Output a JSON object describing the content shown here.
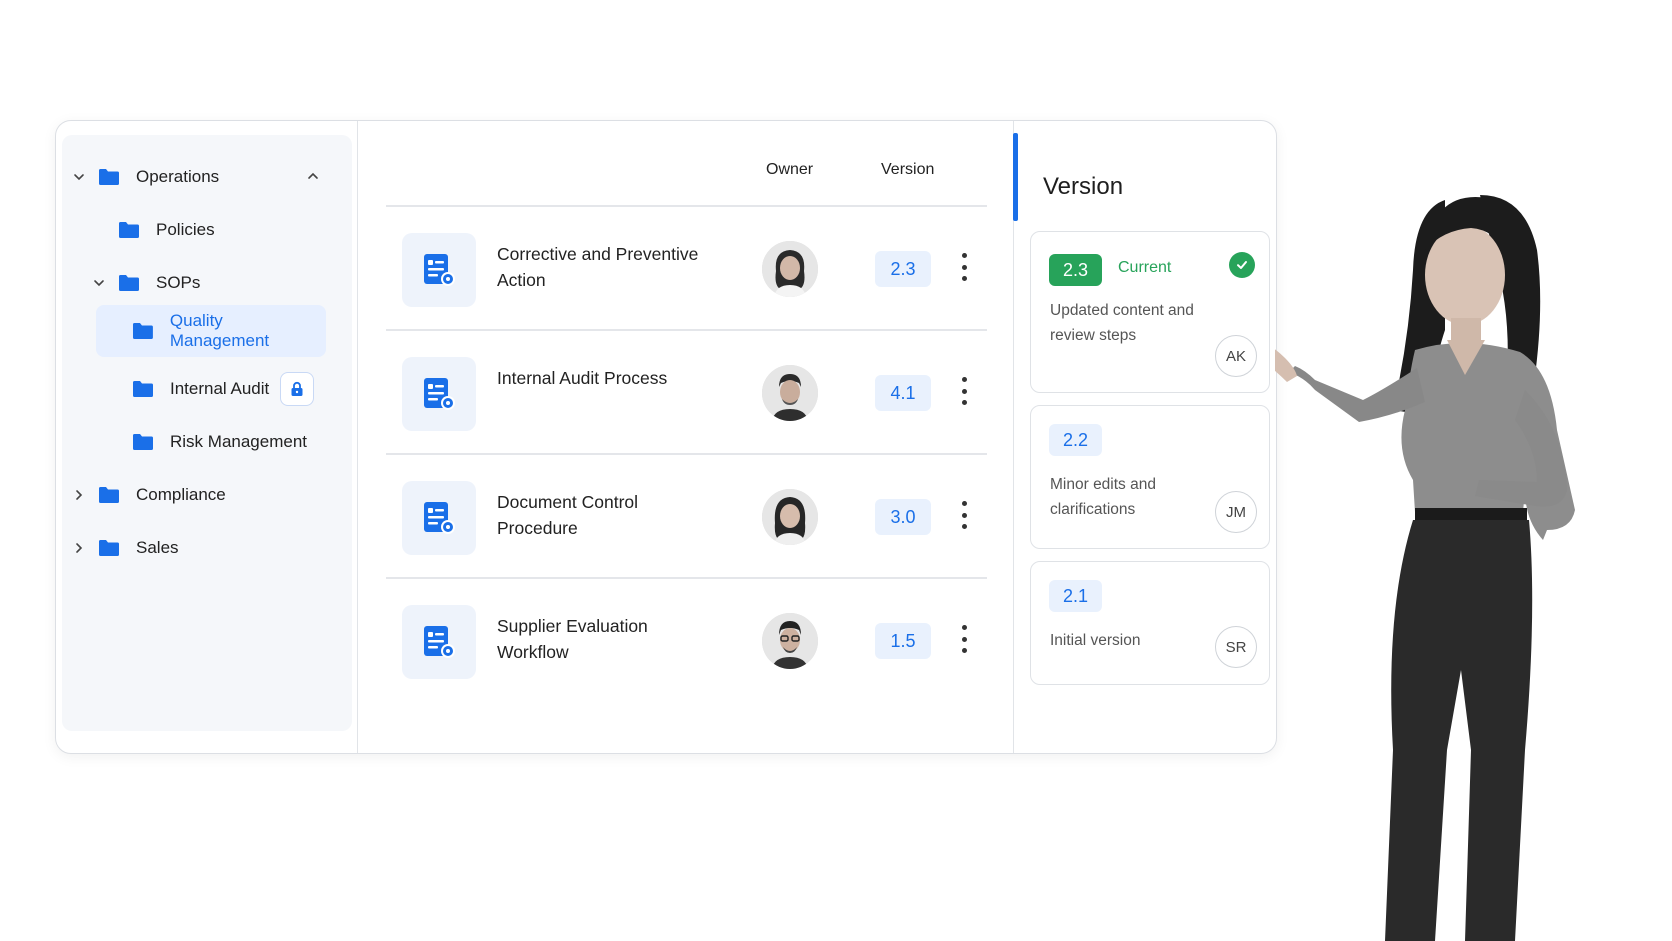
{
  "sidebar": {
    "items": [
      {
        "label": "Operations",
        "icon": "folder-icon",
        "expanded": true
      },
      {
        "label": "Policies",
        "icon": "folder-icon"
      },
      {
        "label": "SOPs",
        "icon": "folder-icon",
        "expanded": true
      },
      {
        "label": "Quality Management",
        "icon": "folder-icon",
        "selected": true
      },
      {
        "label": "Internal Audit",
        "icon": "folder-icon",
        "locked": true
      },
      {
        "label": "Risk Management",
        "icon": "folder-icon"
      },
      {
        "label": "Compliance",
        "icon": "folder-icon",
        "expanded": false
      },
      {
        "label": "Sales",
        "icon": "folder-icon",
        "expanded": false
      }
    ]
  },
  "table": {
    "columns": {
      "owner": "Owner",
      "version": "Version"
    },
    "rows": [
      {
        "title": "Corrective and Preventive Action",
        "owner_avatar": "avatar-woman",
        "version": "2.3"
      },
      {
        "title": "Internal Audit Process",
        "owner_avatar": "avatar-man",
        "version": "4.1"
      },
      {
        "title": "Document Control Procedure",
        "owner_avatar": "avatar-woman",
        "version": "3.0"
      },
      {
        "title": "Supplier Evaluation Workflow",
        "owner_avatar": "avatar-man-glasses",
        "version": "1.5"
      }
    ]
  },
  "version_panel": {
    "title": "Version",
    "cards": [
      {
        "version": "2.3",
        "status": "Current",
        "description": "Updated content and review steps",
        "initials": "AK"
      },
      {
        "version": "2.2",
        "description": "Minor edits and clarifications",
        "initials": "JM"
      },
      {
        "version": "2.1",
        "description": "Initial version",
        "initials": "SR"
      }
    ]
  },
  "colors": {
    "accent": "#1a6fe8",
    "current_green": "#27a35a",
    "selected_bg": "#e6efff"
  }
}
